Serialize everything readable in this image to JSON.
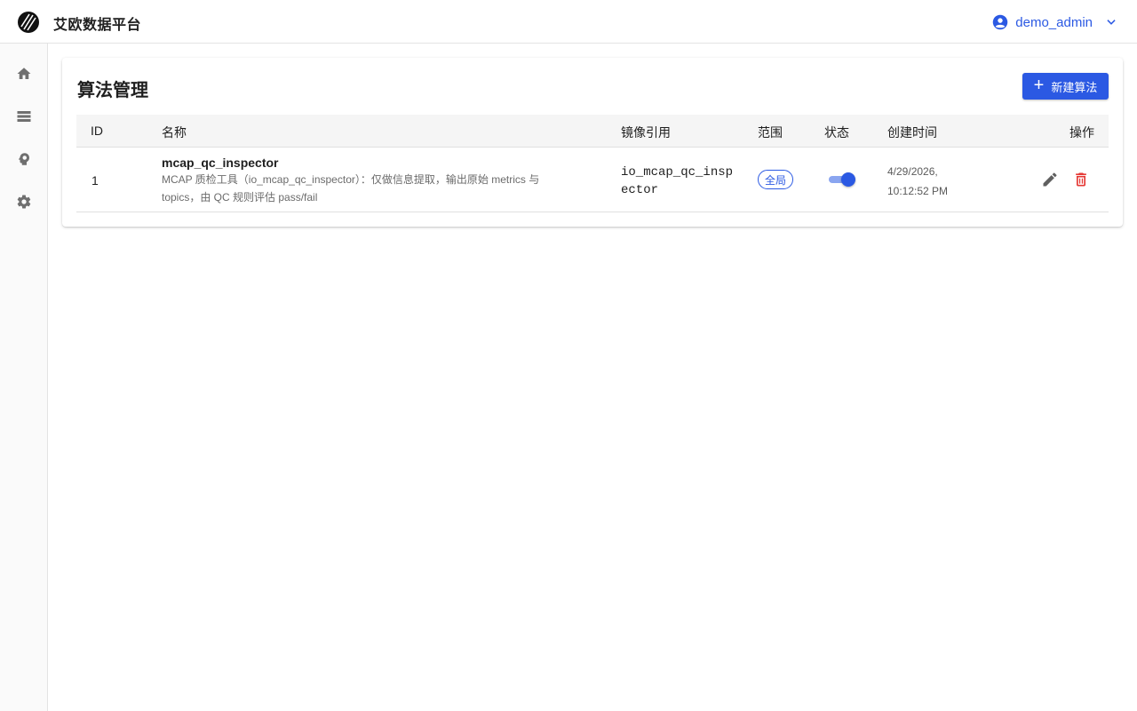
{
  "app": {
    "title": "艾欧数据平台",
    "user": "demo_admin"
  },
  "colors": {
    "accent": "#2b59e3",
    "danger": "#e53935",
    "sidebar_icon": "#6f6f6f"
  },
  "sidebar": {
    "items": [
      {
        "name": "home",
        "icon": "home-icon"
      },
      {
        "name": "data",
        "icon": "storage-icon"
      },
      {
        "name": "algorithm",
        "icon": "psychology-icon"
      },
      {
        "name": "settings",
        "icon": "gear-icon"
      }
    ]
  },
  "page": {
    "title": "算法管理",
    "new_button_label": "新建算法"
  },
  "table": {
    "headers": {
      "id": "ID",
      "name": "名称",
      "image": "镜像引用",
      "scope": "范围",
      "status": "状态",
      "created": "创建时间",
      "actions": "操作"
    },
    "rows": [
      {
        "id": "1",
        "name": "mcap_qc_inspector",
        "description": "MCAP 质检工具（io_mcap_qc_inspector）：仅做信息提取，输出原始 metrics 与 topics，由 QC 规则评估 pass/fail",
        "image": "io_mcap_qc_inspector",
        "scope": "全局",
        "enabled": true,
        "created_date": "4/29/2026,",
        "created_time": "10:12:52 PM"
      }
    ]
  }
}
